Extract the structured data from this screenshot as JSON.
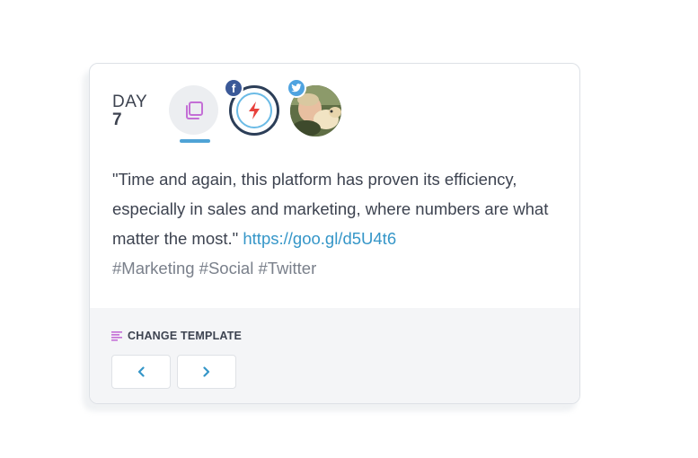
{
  "day": {
    "label": "DAY",
    "number": "7"
  },
  "post_type": {
    "icon": "copy-icon",
    "accent_color": "#c46fd6",
    "selected_indicator_color": "#4fa3d6"
  },
  "accounts": [
    {
      "network": "facebook",
      "badge_icon": "facebook-icon",
      "badge_text": "f",
      "badge_color": "#3b5998",
      "avatar_icon": "lightning-icon"
    },
    {
      "network": "twitter",
      "badge_icon": "twitter-bird-icon",
      "badge_color": "#4fa3e0",
      "avatar": "photo"
    }
  ],
  "post": {
    "text": "\"Time and again, this platform has proven its efficiency, especially in sales and marketing, where numbers are what matter the most.\"",
    "link": "https://goo.gl/d5U4t6",
    "hashtags": "#Marketing #Social #Twitter",
    "link_color": "#3596c8"
  },
  "footer": {
    "change_template_label": "CHANGE TEMPLATE",
    "template_icon": "lines-icon",
    "prev_icon": "chevron-left-icon",
    "next_icon": "chevron-right-icon",
    "prev_symbol": "‹",
    "next_symbol": "›"
  }
}
